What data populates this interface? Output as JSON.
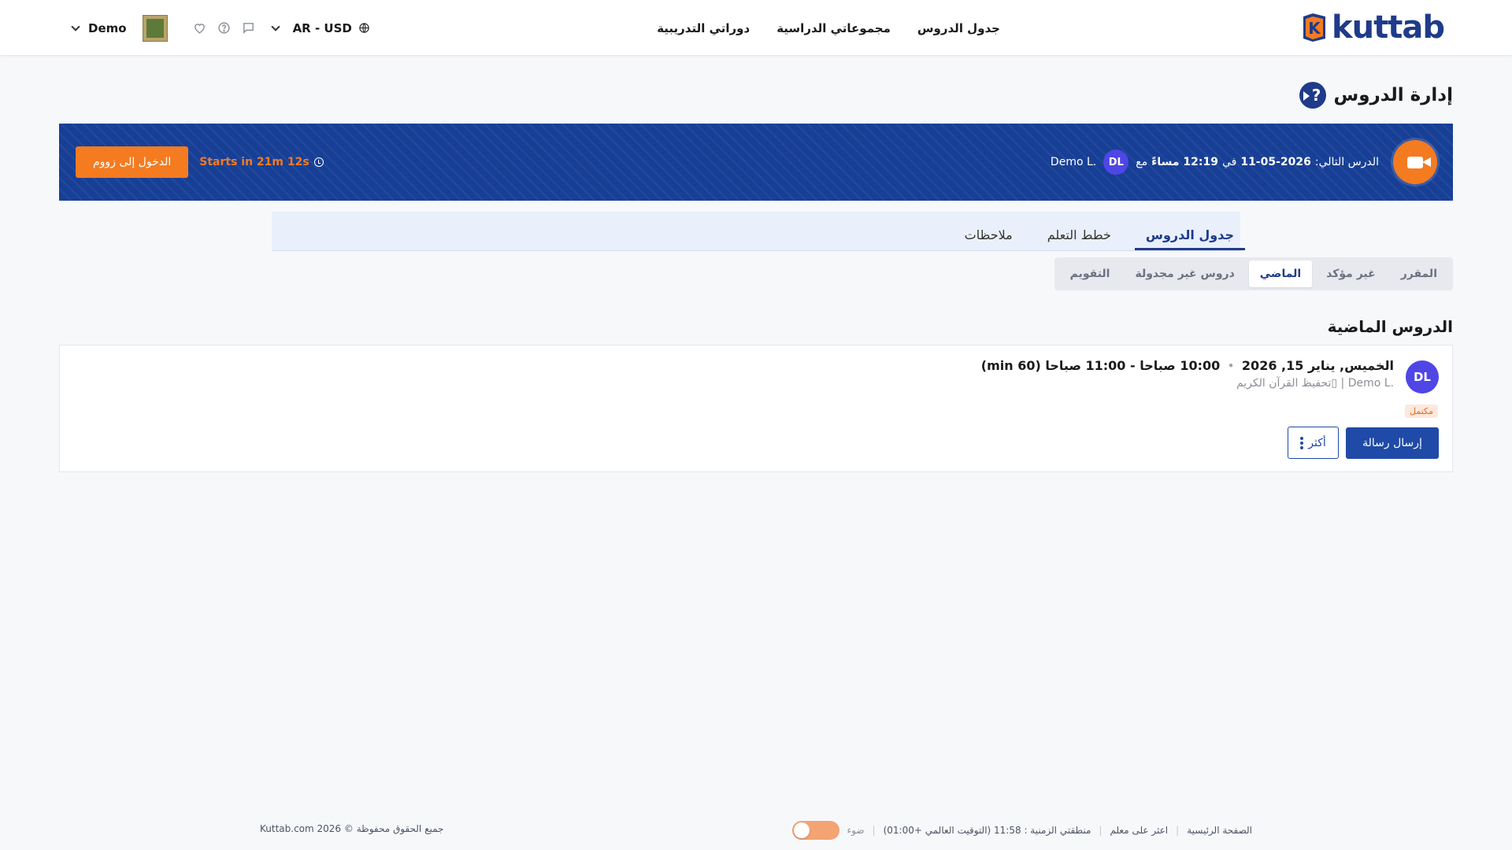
{
  "brand": {
    "name": "kuttab",
    "mark_letter": "K"
  },
  "nav": {
    "items": [
      "جدول الدروس",
      "مجموعاتي الدراسية",
      "دوراتي التدريبية"
    ]
  },
  "header_left": {
    "user_name": "Demo",
    "lang_currency": "AR - USD"
  },
  "page": {
    "title": "إدارة الدروس",
    "help_symbol": "?"
  },
  "banner": {
    "prefix": "الدرس التالي:",
    "date": "11-05-2026",
    "in_word": "في",
    "time": "12:19 مساءً",
    "with_word": "مع",
    "teacher_initials": "DL",
    "teacher_name": "Demo L.",
    "countdown": "Starts in 21m 12s",
    "zoom_label": "الدخول إلى زووم"
  },
  "tabs": [
    "جدول الدروس",
    "خطط التعلم",
    "ملاحظات"
  ],
  "subtabs": [
    "المقرر",
    "غير مؤكد",
    "الماضي",
    "دروس غير مجدولة",
    "التقويم"
  ],
  "section": {
    "title": "الدروس الماضية"
  },
  "lesson": {
    "initials": "DL",
    "date": "الخميس, يناير 15, 2026",
    "time": "10:00 صباحا - 11:00 صباحا (60 min)",
    "teacher": "Demo L.",
    "subject": "تحفيظ القرآن الكريم",
    "status": "مكتمل",
    "send_label": "إرسال رسالة",
    "more_label": "أكثر"
  },
  "footer": {
    "home": "الصفحة الرئيسية",
    "find_teacher": "اعثر على معلم",
    "timezone": "منطقتي الزمنية : 11:58 (التوقيت العالمي +01:00)",
    "theme_label": "ضوء",
    "copyright": "جميع الحقوق محفوظة © 2026 Kuttab.com"
  },
  "colors": {
    "brand_blue": "#1f3b8a",
    "accent_orange": "#f47b20",
    "avatar_purple": "#4f46e5"
  }
}
